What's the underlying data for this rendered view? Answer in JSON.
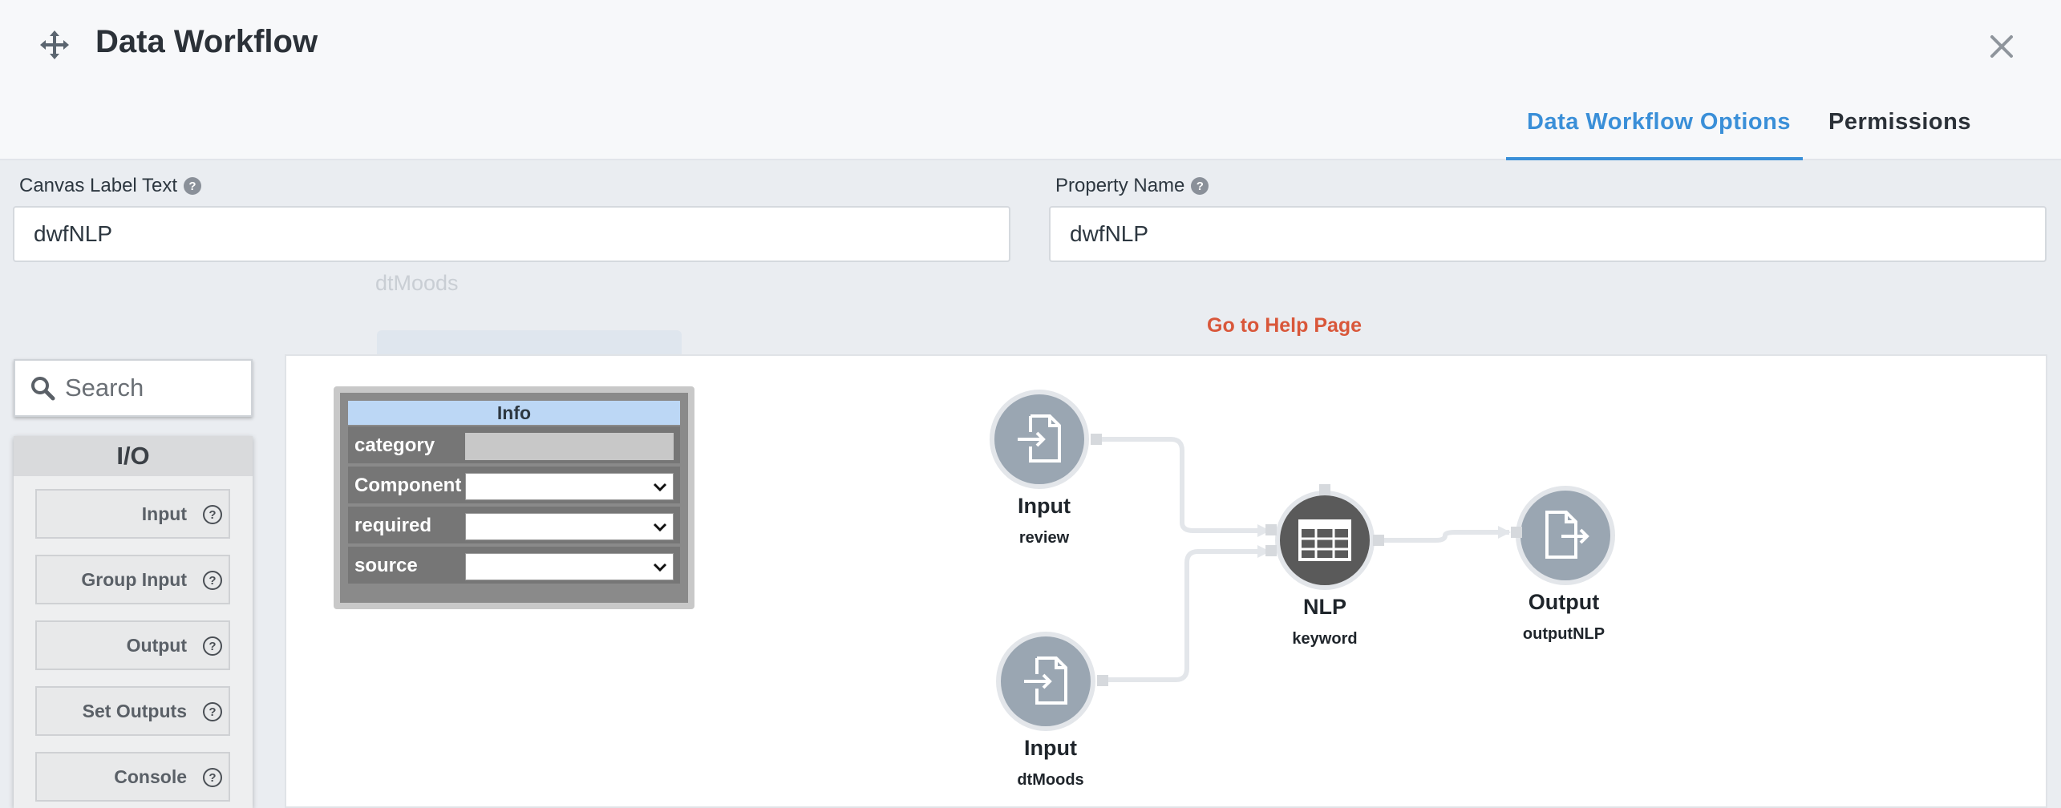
{
  "window": {
    "title": "Data Workflow",
    "move_icon": "move-arrows-icon",
    "close_icon": "close-icon"
  },
  "tabs": [
    {
      "label": "Data Workflow Options",
      "active": true
    },
    {
      "label": "Permissions",
      "active": false
    }
  ],
  "fields": {
    "canvas_label": {
      "label": "Canvas Label Text",
      "value": "dwfNLP"
    },
    "property_name": {
      "label": "Property Name",
      "value": "dwfNLP"
    }
  },
  "background_text": "dtMoods",
  "help_link": "Go to Help Page",
  "search": {
    "placeholder": "Search"
  },
  "palette": {
    "section": "I/O",
    "items": [
      "Input",
      "Group Input",
      "Output",
      "Set Outputs",
      "Console"
    ]
  },
  "info_panel": {
    "title": "Info",
    "rows": [
      {
        "key": "category",
        "value": ""
      },
      {
        "key": "Component",
        "value": ""
      },
      {
        "key": "required",
        "value": ""
      },
      {
        "key": "source",
        "value": ""
      }
    ]
  },
  "nodes": {
    "input_review": {
      "title": "Input",
      "sub": "review"
    },
    "input_dtmoods": {
      "title": "Input",
      "sub": "dtMoods"
    },
    "nlp": {
      "title": "NLP",
      "sub": "keyword"
    },
    "output": {
      "title": "Output",
      "sub": "outputNLP"
    }
  },
  "colors": {
    "accent": "#3a8fd8",
    "help_link": "#d9573a",
    "io_node": "#9aa6b2",
    "nlp_node": "#5a5a5a",
    "info_header": "#bcd7f5"
  }
}
